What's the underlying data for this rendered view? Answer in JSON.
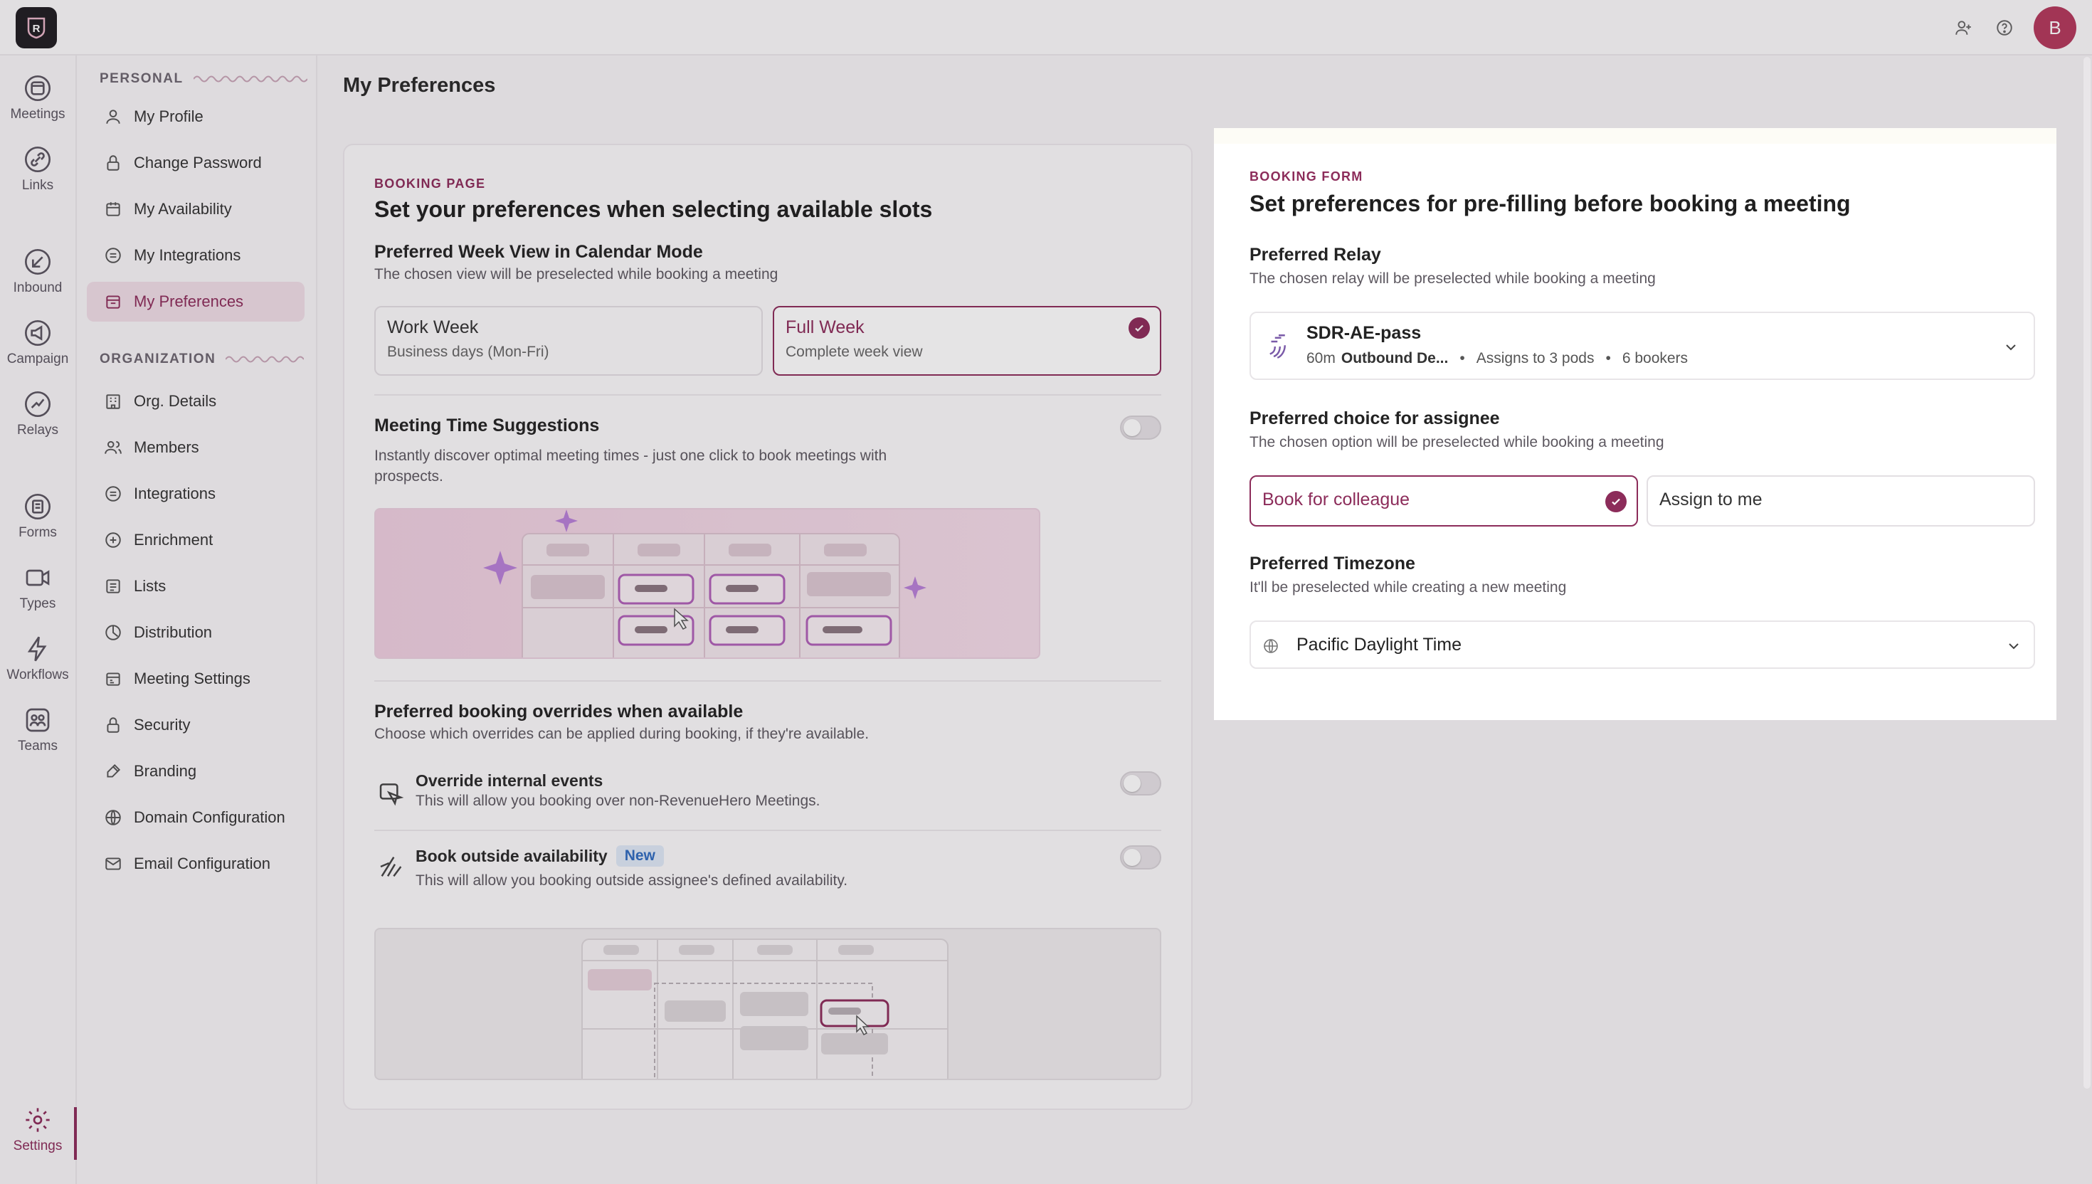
{
  "app": {
    "logo_letter": "R",
    "avatar_letter": "B"
  },
  "rail": [
    {
      "label": "Meetings",
      "icon": "calendar-icon"
    },
    {
      "label": "Links",
      "icon": "link-icon"
    },
    {
      "label": "Inbound",
      "icon": "inbound-icon"
    },
    {
      "label": "Campaign",
      "icon": "megaphone-icon"
    },
    {
      "label": "Relays",
      "icon": "relay-icon"
    },
    {
      "label": "Forms",
      "icon": "form-icon"
    },
    {
      "label": "Types",
      "icon": "video-icon"
    },
    {
      "label": "Workflows",
      "icon": "bolt-icon"
    },
    {
      "label": "Teams",
      "icon": "teams-icon"
    },
    {
      "label": "Settings",
      "icon": "gear-icon"
    }
  ],
  "sidebar": {
    "personal_heading": "PERSONAL",
    "personal": [
      "My Profile",
      "Change Password",
      "My Availability",
      "My Integrations",
      "My Preferences"
    ],
    "org_heading": "ORGANIZATION",
    "org": [
      "Org. Details",
      "Members",
      "Integrations",
      "Enrichment",
      "Lists",
      "Distribution",
      "Meeting Settings",
      "Security",
      "Branding",
      "Domain Configuration",
      "Email Configuration"
    ]
  },
  "page": {
    "title": "My Preferences"
  },
  "booking_page": {
    "kicker": "BOOKING PAGE",
    "title": "Set your preferences when selecting available slots",
    "week_view": {
      "title": "Preferred Week View in Calendar Mode",
      "subtitle": "The chosen view will be preselected while booking a meeting",
      "work_week": {
        "title": "Work Week",
        "desc": "Business days (Mon-Fri)"
      },
      "full_week": {
        "title": "Full Week",
        "desc": "Complete week view"
      }
    },
    "suggestions": {
      "title": "Meeting Time Suggestions",
      "subtitle": "Instantly discover optimal meeting times - just one click to book meetings with prospects."
    },
    "overrides": {
      "title": "Preferred booking overrides when available",
      "subtitle": "Choose which overrides can be applied during booking, if they're available.",
      "internal": {
        "title": "Override internal events",
        "desc": "This will allow you booking over non-RevenueHero Meetings."
      },
      "outside": {
        "title": "Book outside availability",
        "badge": "New",
        "desc": "This will allow you booking outside assignee's defined availability."
      }
    }
  },
  "booking_form": {
    "kicker": "BOOKING FORM",
    "title": "Set preferences for pre-filling before booking a meeting",
    "relay": {
      "title": "Preferred Relay",
      "subtitle": "The chosen relay will be preselected while booking a meeting",
      "name": "SDR-AE-pass",
      "duration": "60m",
      "type": "Outbound De...",
      "pods": "Assigns to 3 pods",
      "bookers": "6 bookers"
    },
    "assignee": {
      "title": "Preferred choice for assignee",
      "subtitle": "The chosen option will be preselected while booking a meeting",
      "colleague": "Book for colleague",
      "me": "Assign to me"
    },
    "timezone": {
      "title": "Preferred Timezone",
      "subtitle": "It'll be preselected while creating a new meeting",
      "value": "Pacific Daylight Time"
    }
  },
  "colors": {
    "accent": "#8c2c5a",
    "avatar": "#b3385c"
  }
}
